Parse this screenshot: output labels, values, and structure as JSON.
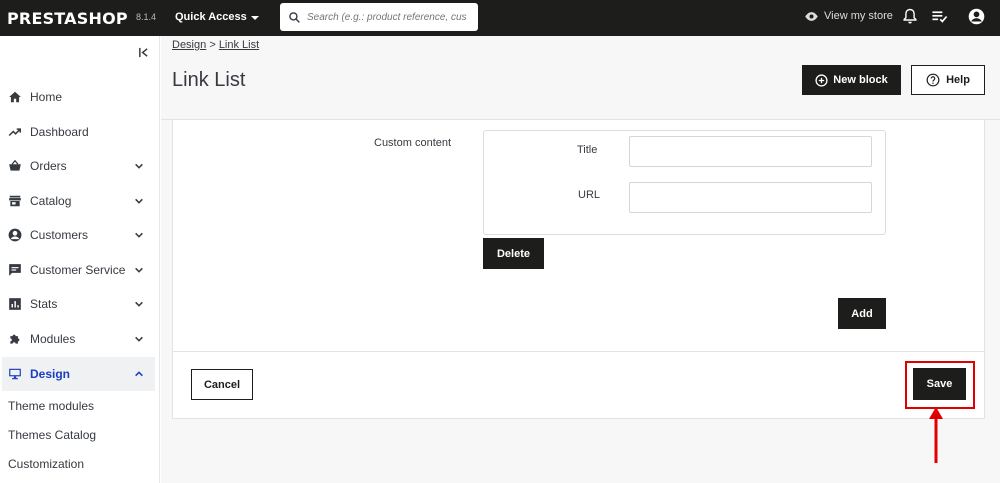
{
  "topbar": {
    "logo": "PRESTASHOP",
    "version": "8.1.4",
    "quick_access": "Quick Access",
    "search_placeholder": "Search (e.g.: product reference, custon",
    "view_store": "View my store"
  },
  "sidebar": {
    "items": [
      {
        "label": "Home",
        "icon": "home-icon"
      },
      {
        "label": "Dashboard",
        "icon": "trending-up-icon"
      },
      {
        "label": "Orders",
        "icon": "shopping-basket-icon"
      },
      {
        "label": "Catalog",
        "icon": "store-icon"
      },
      {
        "label": "Customers",
        "icon": "account-circle-icon"
      },
      {
        "label": "Customer Service",
        "icon": "chat-icon"
      },
      {
        "label": "Stats",
        "icon": "bar-chart-icon"
      },
      {
        "label": "Modules",
        "icon": "puzzle-icon"
      },
      {
        "label": "Design",
        "icon": "desktop-icon"
      }
    ],
    "sub_items": [
      "Theme modules",
      "Themes Catalog",
      "Customization"
    ]
  },
  "header": {
    "breadcrumb_parent": "Design",
    "breadcrumb_sep": ">",
    "breadcrumb_current": "Link List",
    "title": "Link List",
    "new_block": "New block",
    "help": "Help"
  },
  "form": {
    "custom_content_label": "Custom content",
    "title_label": "Title",
    "url_label": "URL",
    "title_value": "",
    "url_value": "",
    "delete": "Delete",
    "add": "Add",
    "cancel": "Cancel",
    "save": "Save"
  },
  "colors": {
    "topbar": "#1d1d1b",
    "active_nav": "#1a3dc0",
    "highlight": "#e00000"
  }
}
